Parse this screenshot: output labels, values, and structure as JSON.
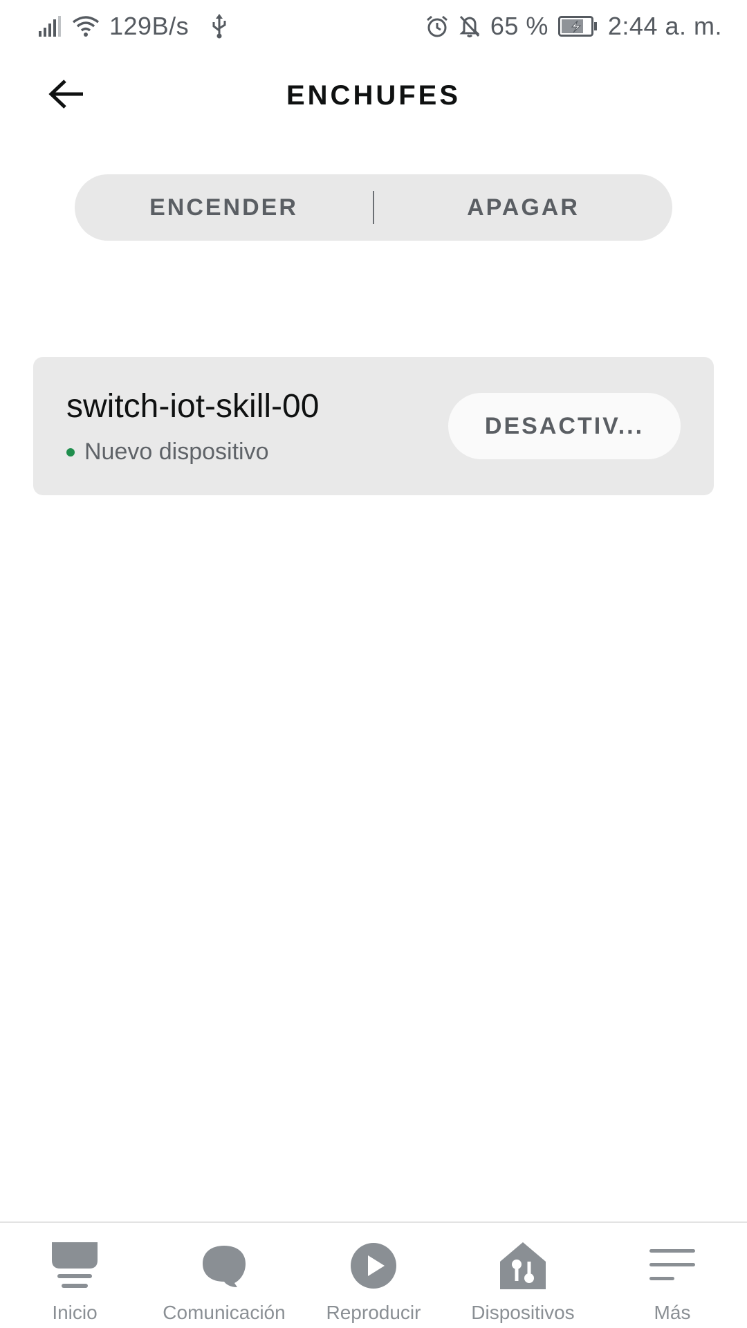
{
  "status_bar": {
    "speed": "129B/s",
    "battery_percent": "65 %",
    "time": "2:44 a. m.",
    "icons": [
      "signal-icon",
      "wifi-icon",
      "usb-icon",
      "alarm-icon",
      "bell-off-icon",
      "battery-icon"
    ]
  },
  "header": {
    "title": "ENCHUFES",
    "back_icon": "arrow-left-icon"
  },
  "segmented_control": {
    "on_label": "ENCENDER",
    "off_label": "APAGAR"
  },
  "devices": [
    {
      "name": "switch-iot-skill-00",
      "status": "Nuevo dispositivo",
      "status_color": "#1f8e4d",
      "action_label": "DESACTIV..."
    }
  ],
  "bottom_nav": {
    "items": [
      {
        "label": "Inicio",
        "icon": "home-icon"
      },
      {
        "label": "Comunicación",
        "icon": "chat-bubble-icon"
      },
      {
        "label": "Reproducir",
        "icon": "play-icon"
      },
      {
        "label": "Dispositivos",
        "icon": "devices-house-icon"
      },
      {
        "label": "Más",
        "icon": "menu-icon"
      }
    ]
  },
  "colors": {
    "text_primary": "#0f1111",
    "text_secondary": "#5a5e63",
    "card_background": "#e9e9e9",
    "nav_gray": "#8a8f94"
  }
}
